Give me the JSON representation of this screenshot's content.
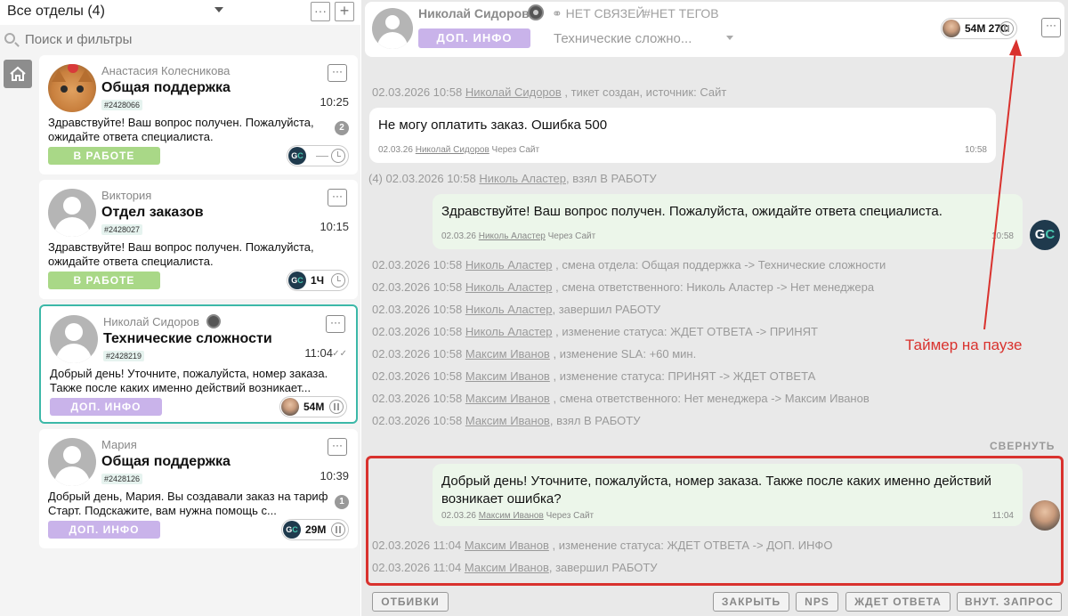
{
  "left": {
    "department_selector": "Все отделы (4)",
    "search_placeholder": "Поиск и фильтры",
    "more_label": "···",
    "add_label": "+"
  },
  "tickets": [
    {
      "name": "Анастасия Колесникова",
      "department": "Общая поддержка",
      "ticket_id": "#2428066",
      "time": "10:25",
      "message": "Здравствуйте! Ваш вопрос получен. Пожалуйста, ожидайте ответа специалиста.",
      "badge": "2",
      "status": "В РАБОТЕ",
      "timer": ""
    },
    {
      "name": "Виктория",
      "department": "Отдел заказов",
      "ticket_id": "#2428027",
      "time": "10:15",
      "message": "Здравствуйте! Ваш вопрос получен. Пожалуйста, ожидайте ответа специалиста.",
      "badge": "",
      "status": "В РАБОТЕ",
      "timer": "1Ч"
    },
    {
      "name": "Николай Сидоров",
      "department": "Технические сложности",
      "ticket_id": "#2428219",
      "time": "11:04",
      "message": "Добрый день! Уточните, пожалуйста, номер заказа. Также после каких именно действий возникает...",
      "badge": "",
      "status": "ДОП. ИНФО",
      "timer": "54М"
    },
    {
      "name": "Мария",
      "department": "Общая поддержка",
      "ticket_id": "#2428126",
      "time": "10:39",
      "message": "Добрый день, Мария. Вы создавали заказ на тариф Старт. Подскажите, вам нужна помощь с...",
      "badge": "1",
      "status": "ДОП. ИНФО",
      "timer": "29М"
    }
  ],
  "header": {
    "client_name": "Николай Сидоров",
    "links": "НЕТ СВЯЗЕЙ",
    "tags": "#НЕТ ТЕГОВ",
    "status": "ДОП. ИНФО",
    "department": "Технические сложно...",
    "timer": "54М 27С"
  },
  "chat": {
    "event_created": {
      "date": "02.03.2026 10:58",
      "user": "Николай Сидоров",
      "text": ", тикет создан, источник: Сайт"
    },
    "msg_client": {
      "text": "Не могу оплатить заказ. Ошибка 500",
      "date": "02.03.26",
      "author": "Николай Сидоров",
      "via": "Через Сайт",
      "time": "10:58"
    },
    "event_taken": {
      "prefix": "(4)",
      "date": "02.03.2026 10:58",
      "user": "Николь Аластер",
      "text": ", взял В РАБОТУ"
    },
    "msg_agent1": {
      "text": "Здравствуйте! Ваш вопрос получен. Пожалуйста, ожидайте ответа специалиста.",
      "date": "02.03.26",
      "author": "Николь Аластер",
      "via": "Через Сайт",
      "time": "10:58"
    },
    "events": [
      {
        "date": "02.03.2026 10:58",
        "user": "Николь Аластер",
        "text": ", смена отдела: Общая поддержка -> Технические сложности"
      },
      {
        "date": "02.03.2026 10:58",
        "user": "Николь Аластер",
        "text": ", смена ответственного: Николь Аластер -> Нет менеджера"
      },
      {
        "date": "02.03.2026 10:58",
        "user": "Николь Аластер",
        "text": ", завершил РАБОТУ"
      },
      {
        "date": "02.03.2026 10:58",
        "user": "Николь Аластер",
        "text": ", изменение статуса: ЖДЕТ ОТВЕТА -> ПРИНЯТ"
      },
      {
        "date": "02.03.2026 10:58",
        "user": "Максим Иванов",
        "text": ", изменение SLA: +60 мин."
      },
      {
        "date": "02.03.2026 10:58",
        "user": "Максим Иванов",
        "text": ", изменение статуса: ПРИНЯТ -> ЖДЕТ ОТВЕТА"
      },
      {
        "date": "02.03.2026 10:58",
        "user": "Максим Иванов",
        "text": ", смена ответственного: Нет менеджера -> Максим Иванов"
      },
      {
        "date": "02.03.2026 10:58",
        "user": "Максим Иванов",
        "text": ", взял В РАБОТУ"
      }
    ],
    "collapse_label": "СВЕРНУТЬ",
    "msg_agent2": {
      "text": "Добрый день! Уточните, пожалуйста, номер заказа. Также после каких именно действий возникает ошибка?",
      "date": "02.03.26",
      "author": "Максим Иванов",
      "via": "Через Сайт",
      "time": "11:04"
    },
    "events_after": [
      {
        "date": "02.03.2026 11:04",
        "user": "Максим Иванов",
        "text": ", изменение статуса: ЖДЕТ ОТВЕТА -> ДОП. ИНФО"
      },
      {
        "date": "02.03.2026 11:04",
        "user": "Максим Иванов",
        "text": ", завершил РАБОТУ"
      }
    ]
  },
  "annotation": "Таймер на паузе",
  "footer": {
    "left_button": "ОТБИВКИ",
    "buttons": [
      "ЗАКРЫТЬ",
      "NPS",
      "ЖДЕТ ОТВЕТА",
      "ВНУТ. ЗАПРОС"
    ]
  },
  "colors": {
    "accent": "#3cb8a8",
    "status_work": "#a9d887",
    "status_info": "#c9b3ea",
    "annotation": "#d9322e",
    "agent_bubble": "#ecf6ea"
  }
}
